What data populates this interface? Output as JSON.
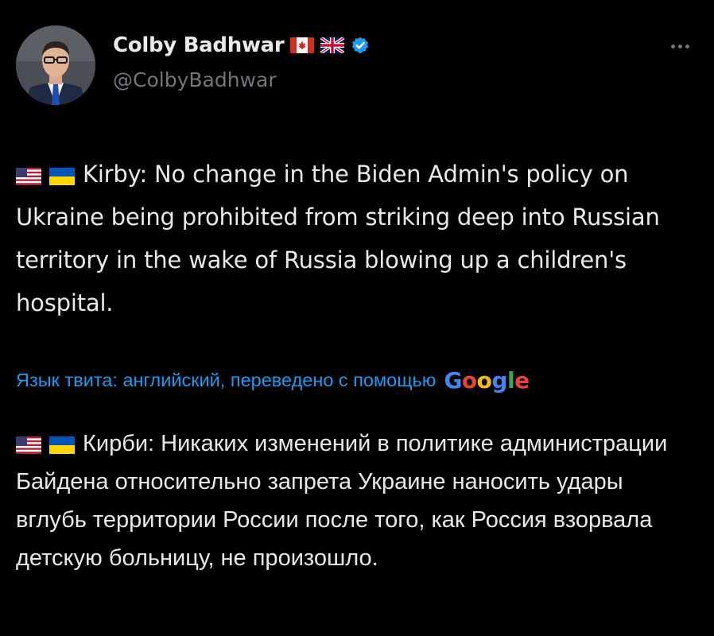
{
  "author": {
    "display_name": "Colby Badhwar",
    "handle": "@ColbyBadhwar",
    "verified": true,
    "name_flags": [
      "canada-flag",
      "uk-flag"
    ],
    "verified_color": "#1d9bf0"
  },
  "tweet": {
    "leading_flags": [
      "usa-flag",
      "ukraine-flag"
    ],
    "text": "Kirby: No change in the Biden Admin's policy on Ukraine being prohibited from striking deep into Russian territory in the wake of Russia blowing up a children's hospital."
  },
  "translation": {
    "label": "Язык твита: английский, переведено с помощью",
    "provider": "Google",
    "leading_flags": [
      "usa-flag",
      "ukraine-flag"
    ],
    "text": "Кирби: Никаких изменений в политике администрации Байдена относительно запрета Украине наносить удары вглубь территории России после того, как Россия взорвала детскую больницу, не произошло."
  },
  "colors": {
    "background": "#000000",
    "text_primary": "#e7e9ea",
    "text_secondary": "#71767b",
    "accent": "#1d9bf0"
  },
  "icons": {
    "more": "more-horizontal-icon"
  }
}
